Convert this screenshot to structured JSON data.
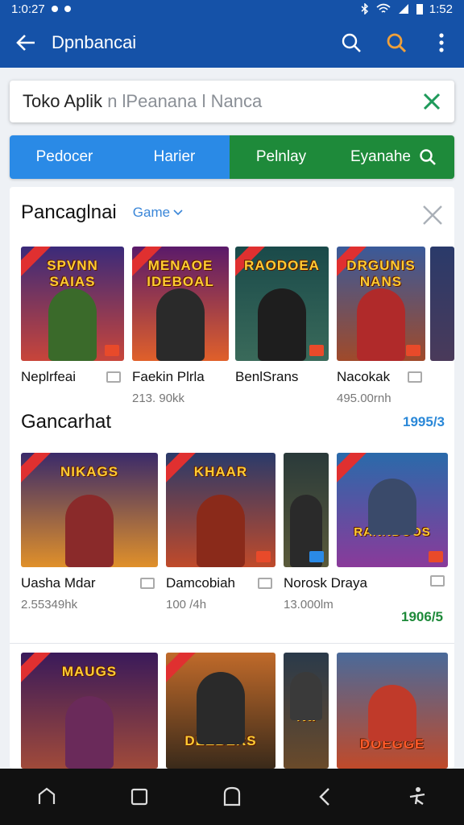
{
  "status": {
    "time_left": "1:0:27",
    "time_right": "1:52"
  },
  "appbar": {
    "title": "Dpnbancai"
  },
  "search": {
    "value": "Toko Aplik",
    "placeholder": "n lPeanana l Nanca"
  },
  "tabs": [
    {
      "label": "Pedocer"
    },
    {
      "label": "Harier"
    },
    {
      "label": "Pelnlay"
    },
    {
      "label": "Eyanahe"
    }
  ],
  "section1": {
    "title": "Pancaglnai",
    "chip": "Game",
    "items": [
      {
        "name": "Neplrfeai",
        "size": "",
        "banner": "SPVNN SAIAS",
        "color_top": "#3a2a7a",
        "color_bottom": "#c8453a",
        "fig": "#3a6a2a"
      },
      {
        "name": "Faekin Plrla",
        "size": "213. 90kk",
        "banner": "MENAOE IDEBOAL",
        "color_top": "#5a1a6a",
        "color_bottom": "#e0602a",
        "fig": "#2a2a2a"
      },
      {
        "name": "BenlSrans",
        "size": "",
        "banner": "RAODOEA",
        "color_top": "#1a4a4a",
        "color_bottom": "#3a6a5a",
        "fig": "#1e1e1e"
      },
      {
        "name": "Nacokak",
        "size": "495.00rnh",
        "banner": "DRGUNIS NANS",
        "color_top": "#3a5a9a",
        "color_bottom": "#a04a2a",
        "fig": "#b02a2a"
      },
      {
        "name": "",
        "size": "",
        "banner": "",
        "color_top": "#2a3a6a",
        "color_bottom": "#4a3a5a",
        "fig": "#555"
      }
    ]
  },
  "section2": {
    "title": "Gancarhat",
    "link": "1995/3",
    "rating": "1906/5",
    "items": [
      {
        "name": "Uasha Mdar",
        "size": "2.55349hk",
        "banner": "NIKAGS",
        "color_top": "#3a2a6a",
        "color_bottom": "#e0902a",
        "fig": "#8a2a2a"
      },
      {
        "name": "Damcobiah",
        "size": "100 /4h",
        "banner": "KHAAR",
        "color_top": "#2a3a6a",
        "color_bottom": "#c04a2a",
        "fig": "#8a2a1a"
      },
      {
        "name": "Norosk Draya",
        "size": "13.000lm",
        "banner": "",
        "color_top": "#2a3a3a",
        "color_bottom": "#5a5a3a",
        "fig": "#2a2a2a"
      },
      {
        "name": "",
        "size": "",
        "banner": "RANNDOOS",
        "color_top": "#2a6aaa",
        "color_bottom": "#8a3a9a",
        "fig": "#3a4a6a"
      }
    ]
  },
  "section3": {
    "items": [
      {
        "banner": "MAUGS",
        "color_top": "#3a1a5a",
        "color_bottom": "#a04a3a",
        "fig": "#6a2a5a"
      },
      {
        "banner": "DEEBERS",
        "color_top": "#c06a2a",
        "color_bottom": "#3a2a1a",
        "fig": "#2a2a2a"
      },
      {
        "banner": "Na",
        "color_top": "#2a3a4a",
        "color_bottom": "#6a4a2a",
        "fig": "#3a3a3a"
      },
      {
        "banner": "DOEGGE",
        "color_top": "#4a6a9a",
        "color_bottom": "#c04a2a",
        "fig": "#c03a2a"
      }
    ]
  },
  "colors": {
    "primary": "#1552a8",
    "tab_blue": "#2a8ae6",
    "tab_green": "#1e8a3a"
  }
}
